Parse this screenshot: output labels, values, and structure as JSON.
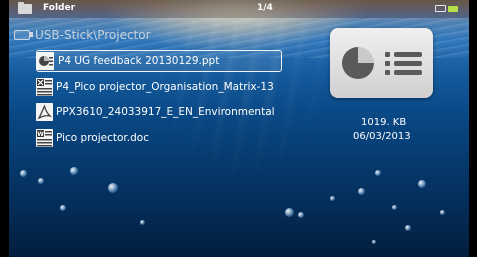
{
  "topbar": {
    "title": "Folder",
    "page": "1/4",
    "left_icon": "folder-icon",
    "right_icons": [
      "tv-icon",
      "battery-icon"
    ]
  },
  "path": {
    "icon": "usb-icon",
    "text": "USB-Stick\\Projector"
  },
  "files": [
    {
      "name": "P4 UG feedback 20130129.ppt",
      "icon": "ppt-file-icon",
      "selected": true
    },
    {
      "name": "P4_Pico projector_Organisation_Matrix-13",
      "icon": "xls-file-icon",
      "selected": false
    },
    {
      "name": "PPX3610_24033917_E_EN_Environmental",
      "icon": "pdf-file-icon",
      "selected": false
    },
    {
      "name": "Pico projector.doc",
      "icon": "doc-file-icon",
      "selected": false
    }
  ],
  "preview": {
    "icon": "presentation-preview-icon",
    "size": "1019. KB",
    "date": "06/03/2013"
  },
  "colors": {
    "accent_battery": "#b6e04a",
    "water_top": "#2a72b8",
    "water_bottom": "#031e3d"
  }
}
